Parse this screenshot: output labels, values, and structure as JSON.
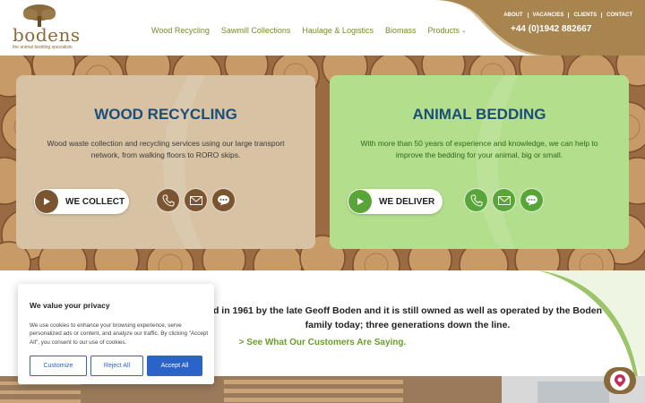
{
  "brand": {
    "name": "bodens",
    "tagline": "the animal bedding specialists"
  },
  "nav": {
    "items": [
      {
        "label": "Wood Recycling"
      },
      {
        "label": "Sawmill Collections"
      },
      {
        "label": "Haulage & Logistics"
      },
      {
        "label": "Biomass"
      },
      {
        "label": "Products"
      }
    ]
  },
  "toplinks": [
    "ABOUT",
    "VACANCIES",
    "CLIENTS",
    "CONTACT"
  ],
  "phone": "+44 (0)1942 882667",
  "cards": {
    "left": {
      "title": "WOOD RECYCLING",
      "text": "Wood waste collection and recycling services using our large transport network, from walking floors to RORO skips.",
      "cta": "WE COLLECT"
    },
    "right": {
      "title": "ANIMAL BEDDING",
      "text": "With more than 50 years of experience and knowledge, we can help to improve the bedding for your animal, big or small.",
      "cta": "WE DELIVER"
    }
  },
  "about": {
    "text": "d in 1961 by the late Geoff Boden and it is still owned as well as operated by the Boden family today; three generations down the line.",
    "link": "> See What Our Customers Are Saying."
  },
  "cookie": {
    "title": "We value your privacy",
    "text": "We use cookies to enhance your browsing experience, serve personalized ads or content, and analyze our traffic. By clicking \"Accept All\", you consent to our use of cookies.",
    "customize": "Customize",
    "reject": "Reject All",
    "accept": "Accept All"
  },
  "colors": {
    "brand_brown": "#8a6a3a",
    "nav_green": "#7a8a2a",
    "title_blue": "#1b4d7a",
    "accept_blue": "#2b63c9",
    "bedding_green": "#5aa53a"
  }
}
